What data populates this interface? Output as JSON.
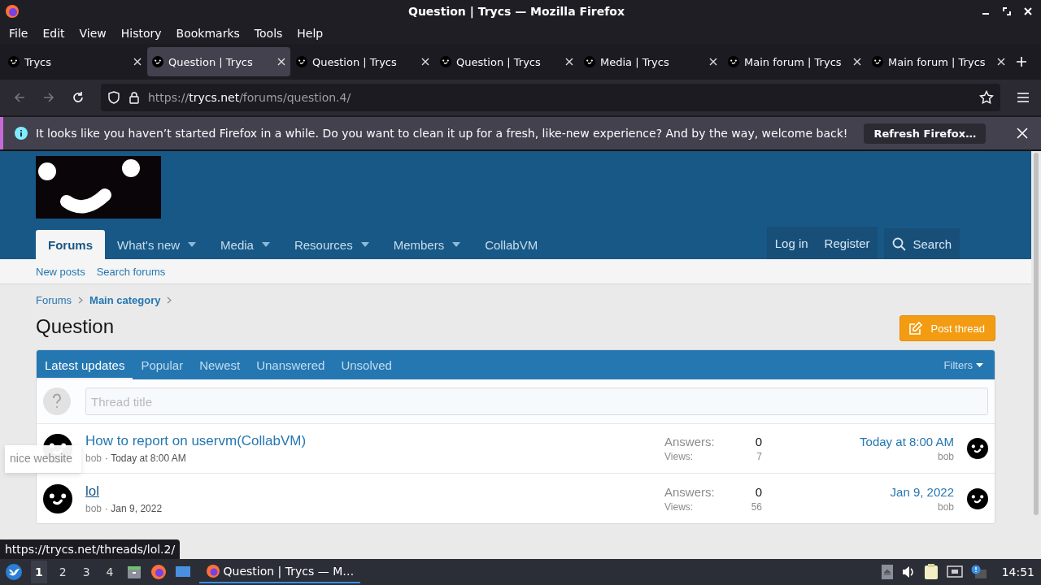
{
  "window": {
    "title": "Question | Trycs — Mozilla Firefox"
  },
  "menu": [
    "File",
    "Edit",
    "View",
    "History",
    "Bookmarks",
    "Tools",
    "Help"
  ],
  "tabs": [
    {
      "label": "Trycs",
      "selected": false
    },
    {
      "label": "Question | Trycs",
      "selected": true
    },
    {
      "label": "Question | Trycs",
      "selected": false
    },
    {
      "label": "Question | Trycs",
      "selected": false
    },
    {
      "label": "Media | Trycs",
      "selected": false
    },
    {
      "label": "Main forum | Trycs",
      "selected": false
    },
    {
      "label": "Main forum | Trycs",
      "selected": false
    }
  ],
  "address": {
    "scheme": "https://",
    "domain": "trycs.net",
    "path": "/forums/question.4/"
  },
  "notification": {
    "message": "It looks like you haven’t started Firefox in a while. Do you want to clean it up for a fresh, like-new experience? And by the way, welcome back!",
    "button": "Refresh Firefox…"
  },
  "site": {
    "nav": [
      {
        "label": "Forums",
        "selected": true,
        "dropdown": false
      },
      {
        "label": "What's new",
        "selected": false,
        "dropdown": true
      },
      {
        "label": "Media",
        "selected": false,
        "dropdown": true
      },
      {
        "label": "Resources",
        "selected": false,
        "dropdown": true
      },
      {
        "label": "Members",
        "selected": false,
        "dropdown": true
      },
      {
        "label": "CollabVM",
        "selected": false,
        "dropdown": false
      }
    ],
    "account": [
      "Log in",
      "Register"
    ],
    "search": "Search",
    "subnav": [
      "New posts",
      "Search forums"
    ],
    "breadcrumbs": [
      {
        "label": "Forums",
        "bold": false
      },
      {
        "label": "Main category",
        "bold": true
      }
    ],
    "title": "Question",
    "post_button": "Post thread",
    "filter_tabs": [
      {
        "label": "Latest updates",
        "selected": true
      },
      {
        "label": "Popular",
        "selected": false
      },
      {
        "label": "Newest",
        "selected": false
      },
      {
        "label": "Unanswered",
        "selected": false
      },
      {
        "label": "Unsolved",
        "selected": false
      }
    ],
    "filters": "Filters",
    "new_thread": {
      "placeholder": "Thread title"
    },
    "threads": [
      {
        "title": "How to report on uservm(CollabVM)",
        "hovered": false,
        "author": "bob",
        "date": "· Today at 8:00 AM",
        "answers_label": "Answers:",
        "answers": "0",
        "views_label": "Views:",
        "views": "7",
        "last_date": "Today at 8:00 AM",
        "last_user": "bob"
      },
      {
        "title": "lol",
        "hovered": true,
        "author": "bob",
        "date": "· Jan 9, 2022",
        "answers_label": "Answers:",
        "answers": "0",
        "views_label": "Views:",
        "views": "56",
        "last_date": "Jan 9, 2022",
        "last_user": "bob"
      }
    ],
    "tooltip": "nice website"
  },
  "status_link": "https://trycs.net/threads/lol.2/",
  "taskbar": {
    "workspaces": [
      {
        "label": "1",
        "selected": true
      },
      {
        "label": "2",
        "selected": false
      },
      {
        "label": "3",
        "selected": false
      },
      {
        "label": "4",
        "selected": false
      }
    ],
    "window_button": "Question | Trycs — M…",
    "clock": "14:51"
  }
}
